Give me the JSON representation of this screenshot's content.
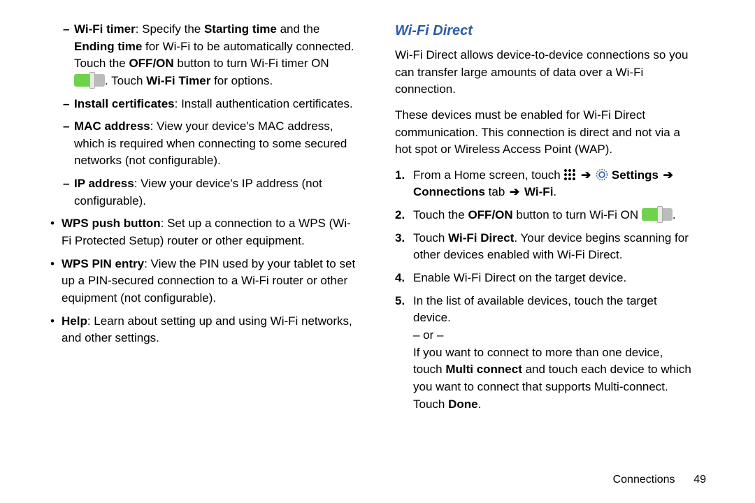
{
  "left": {
    "wifi_timer": {
      "label": "Wi-Fi timer",
      "text_a": ": Specify the ",
      "starting": "Starting time",
      "text_b": " and the ",
      "ending": "Ending time",
      "text_c": " for Wi-Fi to be automatically connected.  Touch the ",
      "offon": "OFF/ON",
      "text_d": " button to turn Wi-Fi timer ON ",
      "text_e": ". Touch ",
      "wifi_timer_bold": "Wi-Fi Timer",
      "text_f": " for options."
    },
    "install_cert": {
      "label": "Install certificates",
      "text": ": Install authentication certificates."
    },
    "mac": {
      "label": "MAC address",
      "text": ": View your device's MAC address, which is required when connecting to some secured networks (not configurable)."
    },
    "ip": {
      "label": "IP address",
      "text": ": View your device's IP address (not configurable)."
    },
    "wps_push": {
      "label": "WPS push button",
      "text": ": Set up a connection to a WPS (Wi-Fi Protected Setup) router or other equipment."
    },
    "wps_pin": {
      "label": "WPS PIN entry",
      "text": ": View the PIN used by your tablet to set up a PIN-secured connection to a Wi-Fi router or other equipment (not configurable)."
    },
    "help": {
      "label": "Help",
      "text": ": Learn about setting up and using Wi-Fi networks, and other settings."
    }
  },
  "right": {
    "heading": "Wi-Fi Direct",
    "intro1": "Wi-Fi Direct allows device-to-device connections so you can transfer large amounts of data over a Wi-Fi connection.",
    "intro2": "These devices must be enabled for Wi-Fi Direct communication. This connection is direct and not via a hot spot or Wireless Access Point (WAP).",
    "step1": {
      "a": "From a Home screen, touch ",
      "settings": "Settings",
      "connections": "Connections",
      "tab_text": " tab ",
      "wifi": "Wi-Fi",
      "period": "."
    },
    "step2": {
      "a": "Touch the ",
      "offon": "OFF/ON",
      "b": " button to turn Wi-Fi ON ",
      "c": "."
    },
    "step3": {
      "a": "Touch ",
      "wifidirect": "Wi-Fi Direct",
      "b": ". Your device begins scanning for other devices enabled with Wi-Fi Direct."
    },
    "step4": "Enable Wi-Fi Direct on the target device.",
    "step5": {
      "a": "In the list of available devices, touch the target device.",
      "or": "– or –",
      "b1": "If you want to connect to more than one device, touch ",
      "multi": "Multi connect",
      "b2": " and touch each device to which you want to connect that supports Multi-connect. Touch ",
      "done": "Done",
      "b3": "."
    }
  },
  "footer": {
    "section": "Connections",
    "page": "49"
  },
  "arrow": "➔"
}
